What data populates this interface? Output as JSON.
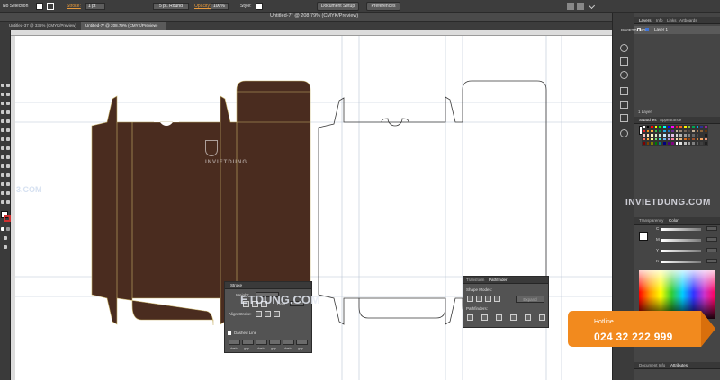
{
  "app": {
    "selection_label": "No Selection",
    "stroke_label": "Stroke:",
    "stroke_weight": "1 pt",
    "brush": "5 pt. Round",
    "opacity_label": "Opacity:",
    "opacity_value": "100%",
    "style_label": "Style:",
    "document_setup_button": "Document Setup",
    "preferences_button": "Preferences",
    "window_title": "Untitled-7* @ 208.79% (CMYK/Preview)"
  },
  "tabs": [
    {
      "label": "Untitled-37 @ 336% (CMYK/Preview)",
      "active": false
    },
    {
      "label": "Untitled-7* @ 208.79% (CMYK/Preview)",
      "active": true
    }
  ],
  "layers_panel": {
    "tabs": [
      "Layers",
      "Info",
      "Links",
      "Artboards"
    ],
    "layer_name": "Layer 1",
    "footer": "1 Layer"
  },
  "swatches_panel": {
    "tabs": [
      "Swatches",
      "Appearance"
    ]
  },
  "color_panel": {
    "tabs": [
      "Transparency",
      "Color"
    ],
    "channels": [
      "C",
      "M",
      "Y",
      "K"
    ]
  },
  "bottom_panel": {
    "tabs": [
      "Document Info",
      "Attributes"
    ]
  },
  "stroke_panel": {
    "title": "Stroke",
    "weight_label": "Weight:",
    "limit_label": "Limit:",
    "align_label": "Align Stroke:",
    "dashed_label": "Dashed Line",
    "dash_labels": [
      "dash",
      "gap",
      "dash",
      "gap",
      "dash",
      "gap"
    ]
  },
  "pathfinder_panel": {
    "tabs": [
      "Transform",
      "Pathfinder"
    ],
    "shape_modes_label": "Shape Modes:",
    "expand_button": "Expand",
    "pathfinders_label": "Pathfinders:"
  },
  "hotline": {
    "title": "Hotline",
    "number": "024 32 222 999"
  },
  "watermarks": {
    "brand": "INVIETDUNG",
    "brand_com": "INVIETDUNG.COM",
    "fragment_left": "3.COM",
    "fragment_mid": "ETDUNG.COM"
  },
  "colors": {
    "box_fill": "#4a2c1f",
    "fold_line": "#c9b36a",
    "hotline_orange": "#f28a1e",
    "accent_orange": "#e89a3c"
  }
}
